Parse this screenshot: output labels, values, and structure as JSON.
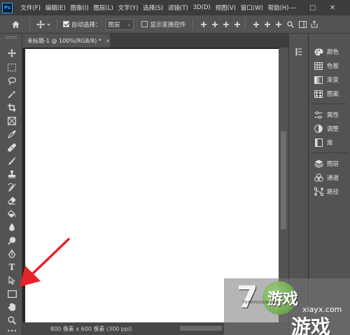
{
  "menubar": {
    "logo": "Ps",
    "items": [
      "文件(F)",
      "编辑(E)",
      "图像(I)",
      "图层(L)",
      "文字(Y)",
      "选择(S)",
      "滤镜(T)",
      "3D(D)",
      "视图(V)",
      "窗口(W)",
      "帮助(H)"
    ],
    "window_controls": {
      "minimize": "—",
      "maximize": "▢",
      "close": "✕"
    }
  },
  "options": {
    "auto_select_label": "自动选择：",
    "auto_select_checked": true,
    "layer_dropdown": "图层",
    "show_transform_label": "显示变换控件",
    "show_transform_checked": false
  },
  "document": {
    "tab_title": "未标题-1 @ 100%(RGB/8) *",
    "close_glyph": "×"
  },
  "status": {
    "text": "800 像素 x 600 像素 (300 ppi)"
  },
  "toolbar": {
    "active_tool": "rectangle-tool",
    "more": "•••"
  },
  "panels": {
    "items": [
      {
        "label": "颜色",
        "icon": "color-palette-icon"
      },
      {
        "label": "色板",
        "icon": "swatches-grid-icon"
      },
      {
        "label": "渐变",
        "icon": "gradient-icon"
      },
      {
        "label": "图案",
        "icon": "pattern-icon"
      },
      {
        "label": "属性",
        "icon": "properties-sliders-icon"
      },
      {
        "label": "调整",
        "icon": "adjustments-icon"
      },
      {
        "label": "库",
        "icon": "library-icon"
      },
      {
        "label": "图层",
        "icon": "layers-icon"
      },
      {
        "label": "通道",
        "icon": "channels-icon"
      },
      {
        "label": "路径",
        "icon": "paths-icon"
      }
    ]
  },
  "watermark": {
    "numeral": "7",
    "cn_top": "游戏",
    "en": "7HAOYOUXIWANG",
    "site": "xiayx.com",
    "cn_bottom": "游戏"
  },
  "colors": {
    "menubar_bg": "#3c3c3c",
    "panel_bg": "#535353",
    "workspace_bg": "#282828",
    "canvas_bg": "#ffffff",
    "annotation_arrow": "#e8222a"
  }
}
